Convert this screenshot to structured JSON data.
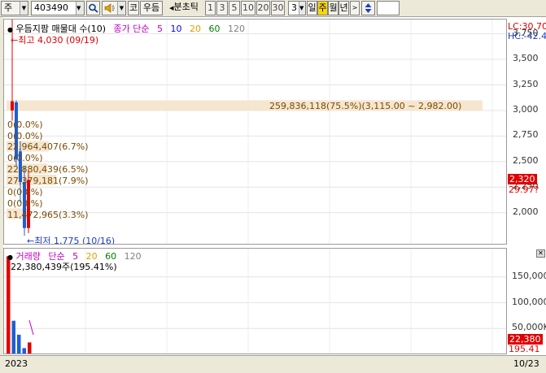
{
  "toolbar": {
    "market": "주",
    "code": "403490",
    "search_icon": "magnifier-icon",
    "sound_icon": "speaker-icon",
    "btn_k": "코",
    "stock_name": "우듬",
    "interval_label": "분초틱",
    "periods": [
      "1",
      "3",
      "5",
      "10",
      "20",
      "30"
    ],
    "count": "3",
    "day": "일",
    "week": "주",
    "month": "월",
    "year": "년",
    "arrow_icon": "up-down-arrow-icon"
  },
  "price_panel": {
    "legend_title": "우듬지팜 매물대 수(10)",
    "legend_price": "종가 단순",
    "ma_periods": [
      {
        "label": "5",
        "color": "#c000c0"
      },
      {
        "label": "10",
        "color": "#0000ff"
      },
      {
        "label": "20",
        "color": "#e0a000"
      },
      {
        "label": "60",
        "color": "#008000"
      },
      {
        "label": "120",
        "color": "#808080"
      }
    ],
    "high_label": "최고 4,030 (09/19)",
    "low_label": "최저 1,775 (10/16)",
    "bands": [
      {
        "label": "259,836,118(75.5%)(3,115.00 ~ 2,982.00)",
        "price": 3048,
        "pct": 75.5
      },
      {
        "label": "0(0.0%)",
        "price": 2870,
        "pct": 0
      },
      {
        "label": "0(0.0%)",
        "price": 2760,
        "pct": 0
      },
      {
        "label": "22,964,407(6.7%)",
        "price": 2650,
        "pct": 6.7
      },
      {
        "label": "0(0.0%)",
        "price": 2540,
        "pct": 0
      },
      {
        "label": "22,880,439(6.5%)",
        "price": 2430,
        "pct": 6.5
      },
      {
        "label": "27,379,181(7.9%)",
        "price": 2320,
        "pct": 7.9
      },
      {
        "label": "0(0.0%)",
        "price": 2210,
        "pct": 0
      },
      {
        "label": "0(0.0%)",
        "price": 2100,
        "pct": 0
      },
      {
        "label": "11,472,965(3.3%)",
        "price": 1990,
        "pct": 3.3
      }
    ],
    "candles": [
      {
        "open": 3000,
        "high": 4030,
        "low": 2900,
        "close": 3090
      },
      {
        "open": 3080,
        "high": 3100,
        "low": 2450,
        "close": 2520
      },
      {
        "open": 2600,
        "high": 2700,
        "low": 2100,
        "close": 2300
      },
      {
        "open": 2300,
        "high": 2450,
        "low": 1775,
        "close": 1850
      },
      {
        "open": 1850,
        "high": 2420,
        "low": 1800,
        "close": 2320
      }
    ],
    "axis_ticks": [
      "3,750",
      "3,500",
      "3,250",
      "3,000",
      "2,750",
      "2,500",
      "2,250",
      "2,000"
    ],
    "lc": "LC:30.70",
    "hc": "HC:-42.4",
    "last_price": "2,320",
    "last_ma": "29.97?"
  },
  "volume_panel": {
    "legend_title": "거래량",
    "legend_price": "단순",
    "ma_periods": [
      {
        "label": "5",
        "color": "#c000c0"
      },
      {
        "label": "20",
        "color": "#e0a000"
      },
      {
        "label": "60",
        "color": "#008000"
      },
      {
        "label": "120",
        "color": "#808080"
      }
    ],
    "value_label": "22,380,439주(195.41%)",
    "axis_ticks": [
      "150,000",
      "100,000",
      "50,000K"
    ],
    "last_vol": "22,380",
    "last_pct": "195.41"
  },
  "chart_data": {
    "type": "bar",
    "title": "",
    "series": [
      {
        "values": [
          190000,
          65000,
          38000,
          12000,
          23000
        ]
      }
    ],
    "ylim": [
      0,
      200000
    ]
  },
  "bottom": {
    "start_label": "2023",
    "end_label": "10/23"
  },
  "colors": {
    "up": "#e00000",
    "down": "#1c5fd4",
    "band": "#f5e6d0",
    "band_text": "#7a4a00"
  }
}
